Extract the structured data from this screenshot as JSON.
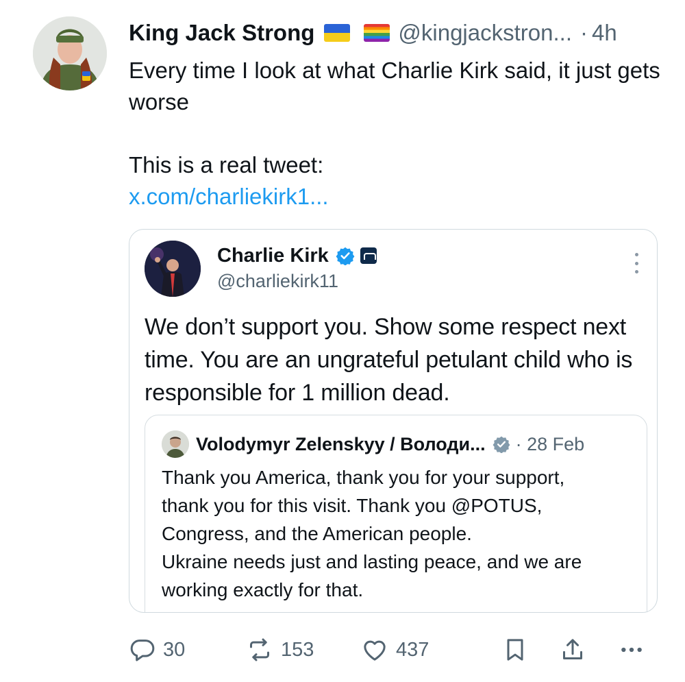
{
  "post": {
    "display_name": "King Jack Strong",
    "flags": [
      "ukraine-flag",
      "pride-flag"
    ],
    "handle": "@kingjackstron...",
    "separator": "·",
    "time": "4h",
    "text_line1": "Every time I look at what Charlie Kirk said, it just gets worse",
    "text_line2": "This is a real tweet:",
    "link": "x.com/charliekirk1..."
  },
  "embedded": {
    "name": "Charlie Kirk",
    "handle": "@charliekirk11",
    "text": "We don’t support you. Show some respect next time. You are an ungrateful petulant child who is responsible for 1 million dead.",
    "quote": {
      "name": "Volodymyr Zelenskyy / Володи...",
      "date": "28 Feb",
      "lines": [
        "Thank you America, thank you for your support,",
        "thank you for this visit. Thank you @POTUS,",
        "Congress, and the American people.",
        "Ukraine needs just and lasting peace, and we are",
        "working exactly for that."
      ]
    }
  },
  "actions": {
    "replies": "30",
    "reposts": "153",
    "likes": "437"
  },
  "colors": {
    "link": "#1d9bf0",
    "secondary_text": "#536471",
    "verified": "#1d9bf0"
  }
}
